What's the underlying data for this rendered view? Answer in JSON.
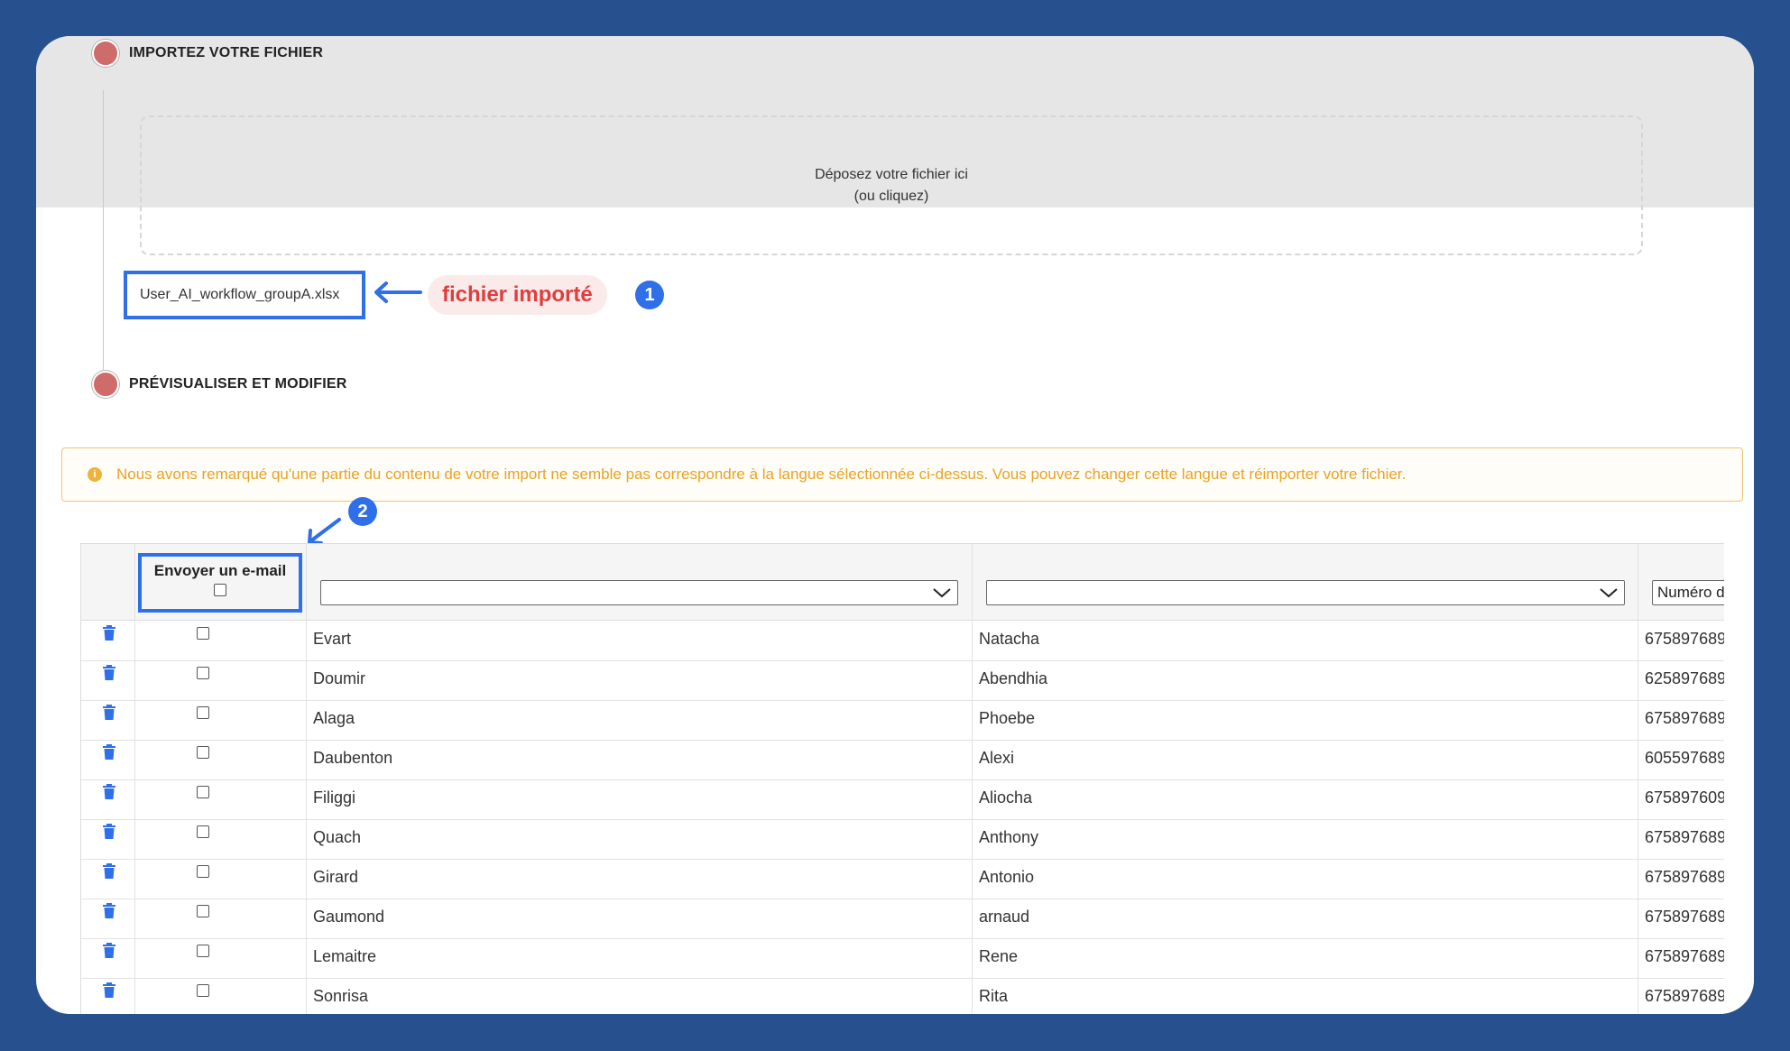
{
  "steps": {
    "import_title": "IMPORTEZ VOTRE FICHIER",
    "preview_title": "PRÉVISUALISER ET MODIFIER"
  },
  "dropzone": {
    "line1": "Déposez votre fichier ici",
    "line2": "(ou cliquez)"
  },
  "file": {
    "name": "User_AI_workflow_groupA.xlsx"
  },
  "annotations": {
    "imported_label": "fichier importé",
    "badge1": "1",
    "badge2": "2"
  },
  "warning": {
    "text": "Nous avons remarqué qu'une partie du contenu de votre import ne semble pas correspondre à la langue sélectionnée ci-dessus. Vous pouvez changer cette langue et réimporter votre fichier."
  },
  "table": {
    "email_header": "Envoyer un e-mail",
    "col3_select": "",
    "col4_select": "",
    "col5_select": "Numéro d",
    "rows": [
      {
        "last": "Evart",
        "first": "Natacha",
        "phone": "675897689"
      },
      {
        "last": "Doumir",
        "first": "Abendhia",
        "phone": "625897689"
      },
      {
        "last": "Alaga",
        "first": "Phoebe",
        "phone": "675897689"
      },
      {
        "last": "Daubenton",
        "first": "Alexi",
        "phone": "605597689"
      },
      {
        "last": "Filiggi",
        "first": "Aliocha",
        "phone": "675897609"
      },
      {
        "last": "Quach",
        "first": "Anthony",
        "phone": "675897689"
      },
      {
        "last": "Girard",
        "first": "Antonio",
        "phone": "675897689"
      },
      {
        "last": "Gaumond",
        "first": "arnaud",
        "phone": "675897689"
      },
      {
        "last": "Lemaitre",
        "first": "Rene",
        "phone": "675897689"
      },
      {
        "last": "Sonrisa",
        "first": "Rita",
        "phone": "675897689"
      }
    ]
  },
  "colors": {
    "background": "#27508f",
    "accent_blue": "#2f6fe8",
    "step_dot": "#cf6b6b",
    "warning_text": "#e9a224",
    "imported_label": "#e03d3d"
  },
  "icons": {
    "trash": "trash-icon",
    "chevron": "chevron-down-icon",
    "info": "info-icon",
    "arrow": "arrow-icon"
  }
}
